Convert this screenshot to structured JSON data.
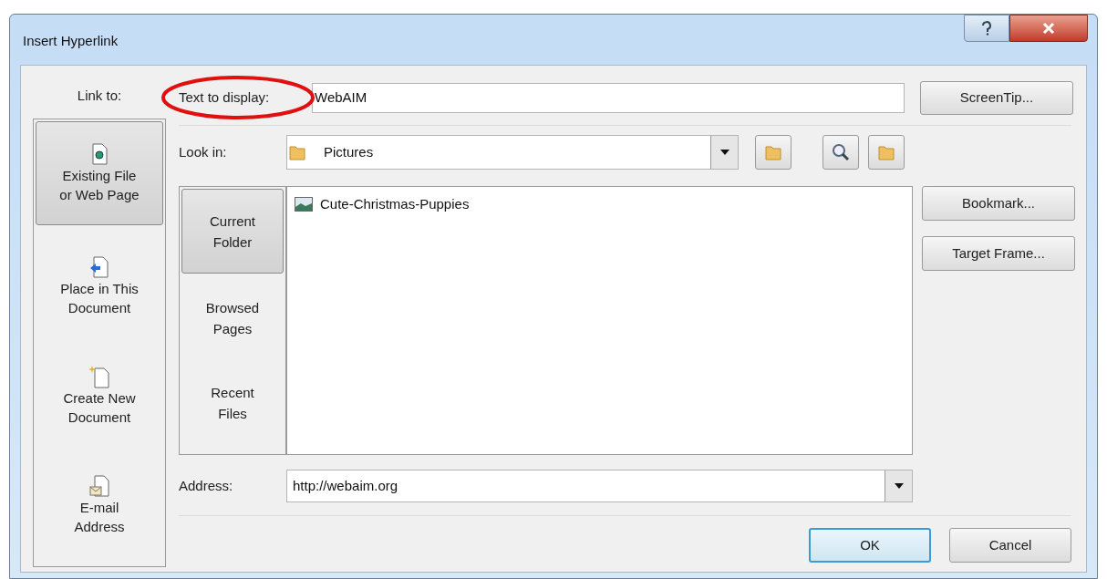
{
  "window": {
    "title": "Insert Hyperlink"
  },
  "link_to": {
    "label": "Link to:",
    "items": [
      {
        "kind": "file",
        "lines": [
          "Existing File",
          "or Web Page"
        ],
        "selected": true
      },
      {
        "kind": "place",
        "lines": [
          "Place in This",
          "Document"
        ],
        "selected": false
      },
      {
        "kind": "new",
        "lines": [
          "Create New",
          "Document"
        ],
        "selected": false
      },
      {
        "kind": "email",
        "lines": [
          "E-mail",
          "Address"
        ],
        "selected": false
      }
    ]
  },
  "text_to_display": {
    "label": "Text to display:",
    "value": "WebAIM",
    "circled": true
  },
  "look_in": {
    "label": "Look in:",
    "value": "Pictures"
  },
  "browse_tabs": [
    {
      "lines": [
        "Current",
        "Folder"
      ],
      "selected": true
    },
    {
      "lines": [
        "Browsed",
        "Pages"
      ],
      "selected": false
    },
    {
      "lines": [
        "Recent",
        "Files"
      ],
      "selected": false
    }
  ],
  "files": [
    {
      "name": "Cute-Christmas-Puppies"
    }
  ],
  "address": {
    "label": "Address:",
    "value": "http://webaim.org"
  },
  "side_buttons": [
    "ScreenTip...",
    "Bookmark...",
    "Target Frame..."
  ],
  "buttons": [
    {
      "label": "OK",
      "default": true
    },
    {
      "label": "Cancel",
      "default": false
    }
  ]
}
